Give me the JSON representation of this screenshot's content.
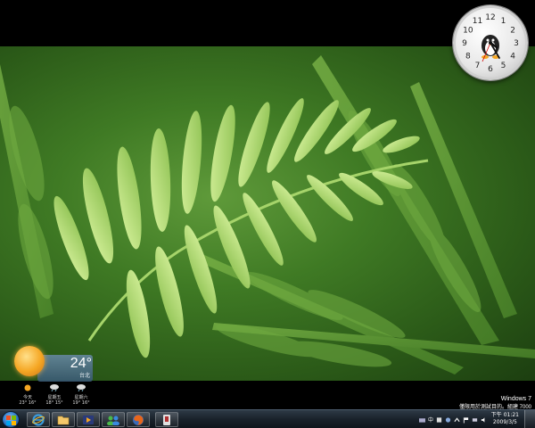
{
  "desktop": {
    "clock": {
      "numerals": [
        "12",
        "1",
        "2",
        "3",
        "4",
        "5",
        "6",
        "7",
        "8",
        "9",
        "10",
        "11"
      ]
    },
    "weather": {
      "temperature": "24°",
      "city": "台北",
      "today_label": "今天",
      "forecast": [
        {
          "day": "星期五",
          "temps": "18° 15°",
          "icon": "cloud-rain-icon"
        },
        {
          "day": "星期六",
          "temps": "19° 16°",
          "icon": "cloud-rain-icon"
        },
        {
          "day": "今天",
          "temps": "23° 16°",
          "icon": "sun-icon"
        }
      ],
      "forecast_order": [
        "今天",
        "星期五",
        "星期六"
      ]
    },
    "watermark": {
      "line1": "Windows 7",
      "line2": "僅限用於測試目的。組建 7000"
    }
  },
  "taskbar": {
    "pinned": [
      {
        "name": "internet-explorer",
        "icon": "ie-icon"
      },
      {
        "name": "windows-explorer",
        "icon": "folder-icon"
      },
      {
        "name": "media-player",
        "icon": "media-player-icon"
      },
      {
        "name": "messenger",
        "icon": "messenger-icon"
      },
      {
        "name": "firefox",
        "icon": "firefox-icon"
      },
      {
        "name": "misc-app",
        "icon": "app-icon"
      }
    ],
    "tray": {
      "time": "下午 01:21",
      "date": "2009/3/5",
      "ime_label": "中"
    }
  },
  "colors": {
    "taskbar": "#1a222b",
    "wallpaper_green": "#4a8a2c",
    "fern_light": "#b5e07a"
  }
}
